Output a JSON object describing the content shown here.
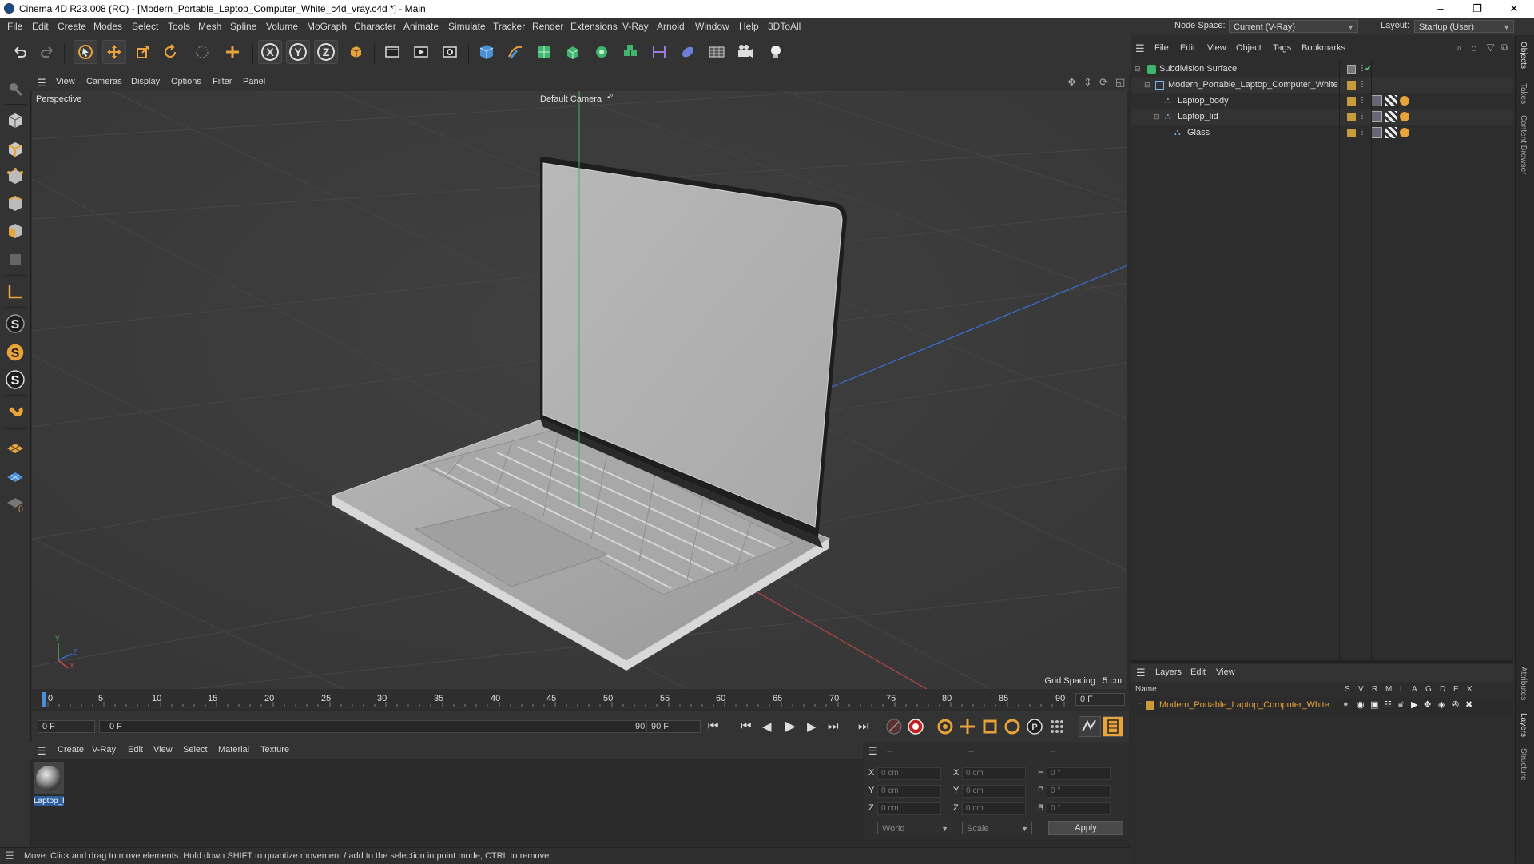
{
  "window": {
    "title": "Cinema 4D R23.008 (RC) - [Modern_Portable_Laptop_Computer_White_c4d_vray.c4d *] - Main",
    "controls": [
      "–",
      "❐",
      "✕"
    ]
  },
  "menu": {
    "items": [
      "File",
      "Edit",
      "Create",
      "Modes",
      "Select",
      "Tools",
      "Mesh",
      "Spline",
      "Volume",
      "MoGraph",
      "Character",
      "Animate",
      "Simulate",
      "Tracker",
      "Render",
      "Extensions",
      "V-Ray",
      "Arnold",
      "Window",
      "Help",
      "3DToAll"
    ],
    "node_space_label": "Node Space:",
    "node_space_value": "Current (V-Ray)",
    "layout_label": "Layout:",
    "layout_value": "Startup (User)"
  },
  "toolbar": {
    "icons": [
      "undo-icon",
      "redo-icon",
      "select-arrow-icon",
      "move-icon",
      "scale-icon",
      "rotate-icon",
      "live-select-icon",
      "create-icon",
      "x-axis-icon",
      "y-axis-icon",
      "z-axis-icon",
      "coordinate-system-icon",
      "render-region-icon",
      "render-view-icon",
      "render-settings-icon",
      "cube-icon",
      "pen-icon",
      "subdivision-icon",
      "extrude-icon",
      "cloner-icon",
      "instance-icon",
      "deformer-icon",
      "field-icon",
      "floor-icon",
      "camera-icon",
      "light-icon"
    ],
    "axis_labels": [
      "X",
      "Y",
      "Z"
    ]
  },
  "viewport": {
    "menu": [
      "View",
      "Cameras",
      "Display",
      "Options",
      "Filter",
      "Panel"
    ],
    "view_name": "Perspective",
    "camera_name": "Default Camera",
    "grid_spacing": "Grid Spacing : 5 cm",
    "axis_labels": [
      "Y",
      "Z",
      "X"
    ]
  },
  "timeline": {
    "ticks": [
      "0",
      "5",
      "10",
      "15",
      "20",
      "25",
      "30",
      "35",
      "40",
      "45",
      "50",
      "55",
      "60",
      "65",
      "70",
      "75",
      "80",
      "85",
      "90"
    ],
    "current_frame": "0 F",
    "start_field": "0 F",
    "range_start": "0 F",
    "range_end": "90 F",
    "end_field": "90 F"
  },
  "materials": {
    "menu": [
      "Create",
      "V-Ray",
      "Edit",
      "View",
      "Select",
      "Material",
      "Texture"
    ],
    "items": [
      {
        "name": "Laptop_l"
      }
    ]
  },
  "coords": {
    "headers": [
      "--",
      "--",
      "--"
    ],
    "rows": [
      {
        "a": "X",
        "av": "0 cm",
        "b": "X",
        "bv": "0 cm",
        "c": "H",
        "cv": "0 °"
      },
      {
        "a": "Y",
        "av": "0 cm",
        "b": "Y",
        "bv": "0 cm",
        "c": "P",
        "cv": "0 °"
      },
      {
        "a": "Z",
        "av": "0 cm",
        "b": "Z",
        "bv": "0 cm",
        "c": "B",
        "cv": "0 °"
      }
    ],
    "mode_world": "World",
    "mode_scale": "Scale",
    "apply": "Apply"
  },
  "status": {
    "message": "Move: Click and drag to move elements. Hold down SHIFT to quantize movement / add to the selection in point mode, CTRL to remove."
  },
  "objects": {
    "menu": [
      "File",
      "Edit",
      "View",
      "Object",
      "Tags",
      "Bookmarks"
    ],
    "rows": [
      {
        "name": "Subdivision Surface"
      },
      {
        "name": "Modern_Portable_Laptop_Computer_White"
      },
      {
        "name": "Laptop_body"
      },
      {
        "name": "Laptop_lid"
      },
      {
        "name": "Glass"
      }
    ]
  },
  "layers": {
    "menu": [
      "Layers",
      "Edit",
      "View"
    ],
    "columns": [
      "Name",
      "S",
      "V",
      "R",
      "M",
      "L",
      "A",
      "G",
      "D",
      "E",
      "X"
    ],
    "rows": [
      {
        "name": "Modern_Portable_Laptop_Computer_White"
      }
    ]
  },
  "side_tabs": [
    "Objects",
    "Takes",
    "Content Browser",
    "Attributes",
    "Layers",
    "Structure"
  ],
  "colors": {
    "accent_orange": "#e8a33a",
    "axis_x": "#c24a4a",
    "axis_y": "#4caf50",
    "axis_z": "#3a6fd6",
    "layer_color": "#c89a3a"
  }
}
